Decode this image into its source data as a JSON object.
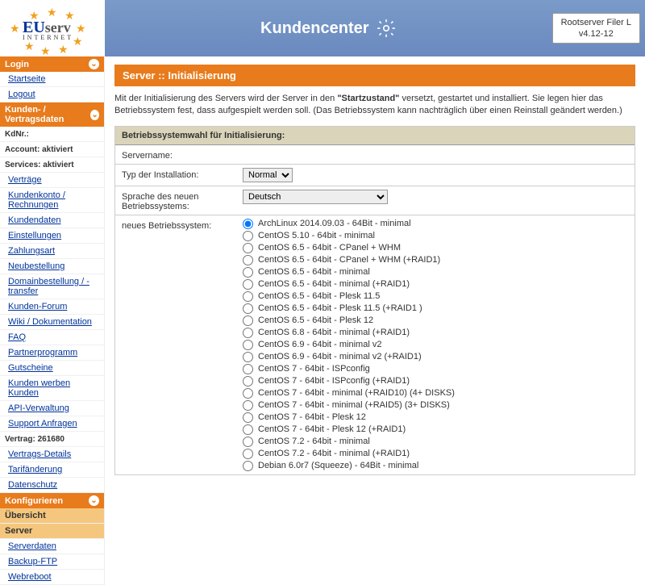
{
  "header": {
    "logo": {
      "l1": "EU",
      "l2": "serv",
      "l3": "INTERNET"
    },
    "title": "Kundencenter",
    "right": {
      "line1": "Rootserver Filer L",
      "line2": "v4.12-12"
    }
  },
  "sidebar": {
    "sections": [
      {
        "type": "head",
        "label": "Login"
      },
      {
        "type": "link",
        "label": "Startseite"
      },
      {
        "type": "link",
        "label": "Logout"
      },
      {
        "type": "head",
        "label": "Kunden- / Vertragsdaten"
      },
      {
        "type": "row",
        "key": "KdNr.:",
        "val": ""
      },
      {
        "type": "row",
        "key": "Account: aktiviert",
        "val": ""
      },
      {
        "type": "row",
        "key": "Services: aktiviert",
        "val": ""
      },
      {
        "type": "link",
        "label": "Verträge"
      },
      {
        "type": "link",
        "label": "Kundenkonto / Rechnungen"
      },
      {
        "type": "link",
        "label": "Kundendaten"
      },
      {
        "type": "link",
        "label": "Einstellungen"
      },
      {
        "type": "link",
        "label": "Zahlungsart"
      },
      {
        "type": "link",
        "label": "Neubestellung"
      },
      {
        "type": "link",
        "label": "Domainbestellung / -transfer"
      },
      {
        "type": "link",
        "label": "Kunden-Forum"
      },
      {
        "type": "link",
        "label": "Wiki / Dokumentation"
      },
      {
        "type": "link",
        "label": "FAQ"
      },
      {
        "type": "link",
        "label": "Partnerprogramm"
      },
      {
        "type": "link",
        "label": "Gutscheine"
      },
      {
        "type": "link",
        "label": "Kunden werben Kunden"
      },
      {
        "type": "link",
        "label": "API-Verwaltung"
      },
      {
        "type": "link",
        "label": "Support Anfragen"
      },
      {
        "type": "row",
        "key": "Vertrag: 261680",
        "val": ""
      },
      {
        "type": "link",
        "label": "Vertrags-Details"
      },
      {
        "type": "link",
        "label": "Tarifänderung"
      },
      {
        "type": "link",
        "label": "Datenschutz"
      },
      {
        "type": "head",
        "label": "Konfigurieren"
      },
      {
        "type": "hl",
        "label": "Übersicht"
      },
      {
        "type": "hl-bold",
        "label": "Server"
      },
      {
        "type": "link",
        "label": "Serverdaten"
      },
      {
        "type": "link",
        "label": "Backup-FTP"
      },
      {
        "type": "link",
        "label": "Webreboot"
      }
    ]
  },
  "page": {
    "title": "Server :: Initialisierung",
    "intro_pre": "Mit der Initialisierung des Servers wird der Server in den ",
    "intro_bold": "\"Startzustand\"",
    "intro_post": " versetzt, gestartet und installiert. Sie legen hier das Betriebssystem fest, dass aufgespielt werden soll. (Das Betriebssystem kann nachträglich über einen Reinstall geändert werden.)"
  },
  "form": {
    "panel_title": "Betriebssystemwahl für Initialisierung:",
    "servername_label": "Servername:",
    "servername_value": "",
    "installtype_label": "Typ der Installation:",
    "installtype_options": [
      "Normal"
    ],
    "lang_label": "Sprache des neuen Betriebssystems:",
    "lang_options": [
      "Deutsch"
    ],
    "os_label": "neues Betriebssystem:",
    "os_selected": 0,
    "os_options": [
      "ArchLinux 2014.09.03 - 64Bit - minimal",
      "CentOS 5.10 - 64bit - minimal",
      "CentOS 6.5 - 64bit - CPanel + WHM",
      "CentOS 6.5 - 64bit - CPanel + WHM (+RAID1)",
      "CentOS 6.5 - 64bit - minimal",
      "CentOS 6.5 - 64bit - minimal (+RAID1)",
      "CentOS 6.5 - 64bit - Plesk 11.5",
      "CentOS 6.5 - 64bit - Plesk 11.5 (+RAID1 )",
      "CentOS 6.5 - 64bit - Plesk 12",
      "CentOS 6.8 - 64bit - minimal (+RAID1)",
      "CentOS 6.9 - 64bit - minimal v2",
      "CentOS 6.9 - 64bit - minimal v2 (+RAID1)",
      "CentOS 7 - 64bit - ISPconfig",
      "CentOS 7 - 64bit - ISPconfig (+RAID1)",
      "CentOS 7 - 64bit - minimal (+RAID10) (4+ DISKS)",
      "CentOS 7 - 64bit - minimal (+RAID5) (3+ DISKS)",
      "CentOS 7 - 64bit - Plesk 12",
      "CentOS 7 - 64bit - Plesk 12 (+RAID1)",
      "CentOS 7.2 - 64bit - minimal",
      "CentOS 7.2 - 64bit - minimal (+RAID1)",
      "Debian 6.0r7 (Squeeze) - 64Bit - minimal"
    ]
  }
}
